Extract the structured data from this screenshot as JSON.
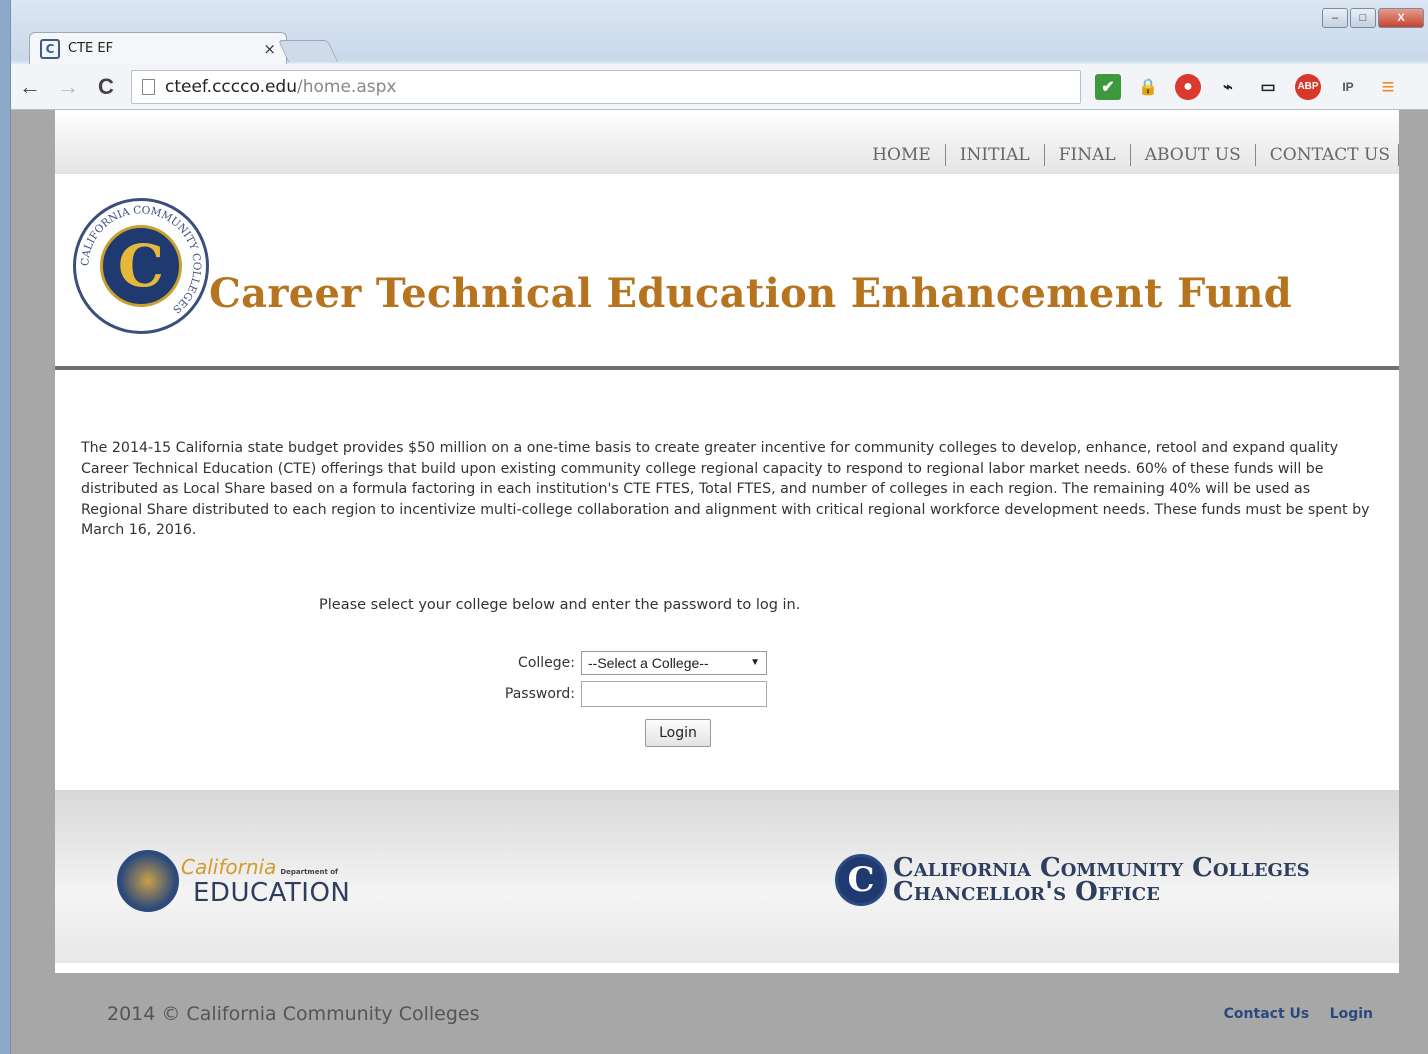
{
  "browser": {
    "tab_title": "CTE EF",
    "tab_favicon": "C",
    "tab_close": "×",
    "url_host": "cteef.cccco.edu",
    "url_path": "/home.aspx",
    "window_controls": {
      "minimize": "–",
      "maximize": "□",
      "close": "X"
    },
    "nav": {
      "back": "←",
      "forward": "→",
      "reload": "C"
    },
    "extensions": [
      {
        "icon": "checkmark-icon",
        "glyph": "✔"
      },
      {
        "icon": "lock-icon",
        "glyph": "🔒"
      },
      {
        "icon": "stop-icon",
        "glyph": "●"
      },
      {
        "icon": "pulse-icon",
        "glyph": "⌁"
      },
      {
        "icon": "cast-icon",
        "glyph": "▭"
      },
      {
        "icon": "adblock-icon",
        "glyph": "ABP"
      },
      {
        "icon": "ip-icon",
        "glyph": "IP"
      },
      {
        "icon": "menu-icon",
        "glyph": "≡"
      }
    ]
  },
  "topnav": [
    "HOME",
    "INITIAL",
    "FINAL",
    "ABOUT US",
    "CONTACT US"
  ],
  "header": {
    "seal_ring": "CALIFORNIA COMMUNITY COLLEGES",
    "seal_letter": "C",
    "title": "Career Technical Education Enhancement Fund"
  },
  "content": {
    "intro": "The 2014-15 California state budget provides $50 million on a one-time basis to create greater incentive for community colleges to develop, enhance, retool and expand quality Career Technical Education (CTE) offerings that build upon existing community college regional capacity to respond to regional labor market needs. 60% of these funds will be distributed as Local Share based on a formula factoring in each institution's CTE FTES, Total FTES, and number of colleges in each region. The remaining 40% will be used as Regional Share distributed to each region to incentivize multi-college collaboration and alignment with critical regional workforce development needs. These funds must be spent by March 16, 2016.",
    "login_prompt": "Please select your college below and enter the password to log in.",
    "college_label": "College:",
    "college_selected": "--Select a College--",
    "password_label": "Password:",
    "password_value": "",
    "login_button": "Login"
  },
  "logos": {
    "cde_california": "California",
    "cde_dept": "Department of",
    "cde_education": "EDUCATION",
    "ccco_line1": "California Community Colleges",
    "ccco_line2": "Chancellor's Office",
    "ccco_letter": "C"
  },
  "footer": {
    "copyright": "2014 © California Community Colleges",
    "links": [
      "Contact Us",
      "Login"
    ]
  }
}
